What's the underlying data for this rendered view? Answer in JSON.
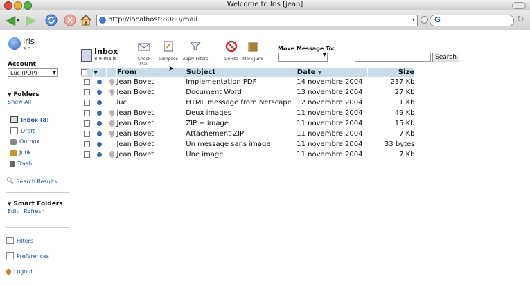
{
  "window": {
    "title": "Welcome to Iris [jean]"
  },
  "browser": {
    "url": "http://localhost:8080/mail",
    "search_logo": "G"
  },
  "app": {
    "name": "Iris",
    "version": "3.0"
  },
  "sidebar": {
    "account_label": "Account",
    "account_value": "Luc (POP)",
    "folders_title": "Folders",
    "show_all": "Show All",
    "folders": [
      {
        "label": "Inbox (8)",
        "icon": "inbox-icon",
        "active": true
      },
      {
        "label": "Draft",
        "icon": "draft-icon"
      },
      {
        "label": "Outbox",
        "icon": "outbox-icon"
      },
      {
        "label": "Junk",
        "icon": "junk-icon"
      },
      {
        "label": "Trash",
        "icon": "trash-icon"
      }
    ],
    "search_results": "Search Results",
    "smart_folders_title": "Smart Folders",
    "smart_edit": "Edit",
    "smart_sep": "|",
    "smart_refresh": "Refresh",
    "filters": "Filters",
    "preferences": "Preferences",
    "logout": "Logout"
  },
  "main": {
    "inbox_title": "Inbox",
    "inbox_count": "8 e-mails",
    "actions": [
      "Check Mail",
      "Compose",
      "Apply Filters",
      "Delete",
      "Mark Junk"
    ],
    "move_label": "Move Message To:",
    "search_button": "Search"
  },
  "table": {
    "headers": {
      "from": "From",
      "subject": "Subject",
      "date": "Date",
      "size": "Size"
    },
    "rows": [
      {
        "from": "Jean Bovet",
        "subject": "Implementation PDF",
        "date": "14 novembre 2004",
        "size": "237 Kb",
        "attach": true
      },
      {
        "from": "Jean Bovet",
        "subject": "Document Word",
        "date": "13 novembre 2004",
        "size": "27 Kb",
        "attach": true
      },
      {
        "from": "luc",
        "subject": "HTML message from Netscape",
        "date": "12 novembre 2004",
        "size": "1 Kb",
        "attach": false
      },
      {
        "from": "Jean Bovet",
        "subject": "Deux images",
        "date": "11 novembre 2004",
        "size": "49 Kb",
        "attach": true
      },
      {
        "from": "Jean Bovet",
        "subject": "ZIP + image",
        "date": "11 novembre 2004",
        "size": "15 Kb",
        "attach": true
      },
      {
        "from": "Jean Bovet",
        "subject": "Attachement ZIP",
        "date": "11 novembre 2004",
        "size": "7 Kb",
        "attach": true
      },
      {
        "from": "Jean Bovet",
        "subject": "Un message sans image",
        "date": "11 novembre 2004",
        "size": "33 bytes",
        "attach": false
      },
      {
        "from": "Jean Bovet",
        "subject": "Une image",
        "date": "11 novembre 2004",
        "size": "7 Kb",
        "attach": true
      }
    ]
  }
}
